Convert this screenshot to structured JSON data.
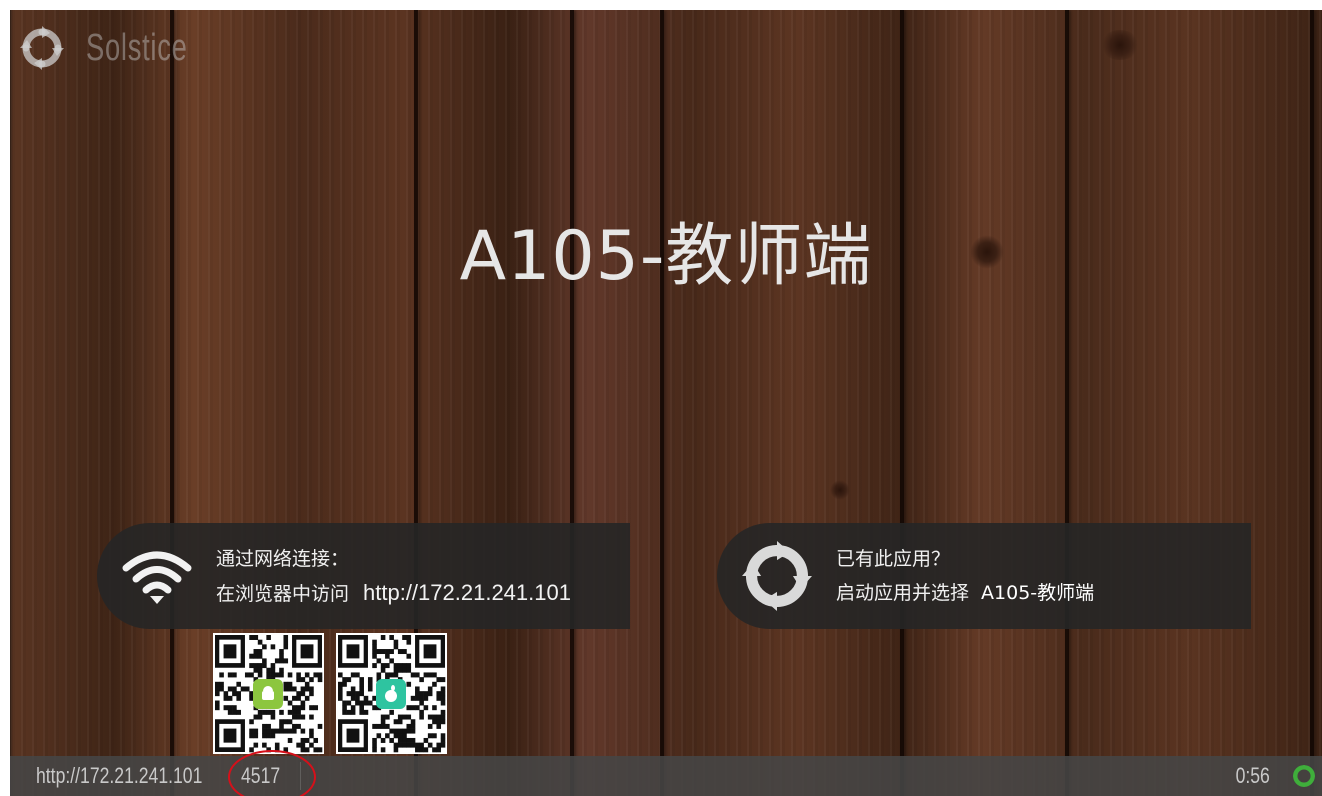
{
  "brand": {
    "name": "Solstice",
    "icon": "solstice-logo-icon"
  },
  "room_title": "A105-教师端",
  "network_panel": {
    "icon": "wifi-icon",
    "line1": "通过网络连接：",
    "line2_prefix": "在浏览器中访问",
    "url": "http://172.21.241.101"
  },
  "app_panel": {
    "icon": "solstice-logo-icon",
    "line1": "已有此应用？",
    "line2_prefix": "启动应用并选择",
    "room_name": "A105-教师端"
  },
  "qr_codes": [
    {
      "name": "android-app-qr",
      "badge_icon": "android-icon",
      "badge_color": "#8cc63f"
    },
    {
      "name": "ios-app-qr",
      "badge_icon": "apple-icon",
      "badge_color": "#2ec4a0"
    }
  ],
  "status_bar": {
    "url": "http://172.21.241.101",
    "screen_key": "4517",
    "time": "0:56",
    "spinner_icon": "loading-spinner-icon",
    "spinner_color": "#3fae3b"
  },
  "colors": {
    "annotation_circle": "#d6101a",
    "panel_background": "#262626",
    "title_text": "#e6e6e6"
  }
}
